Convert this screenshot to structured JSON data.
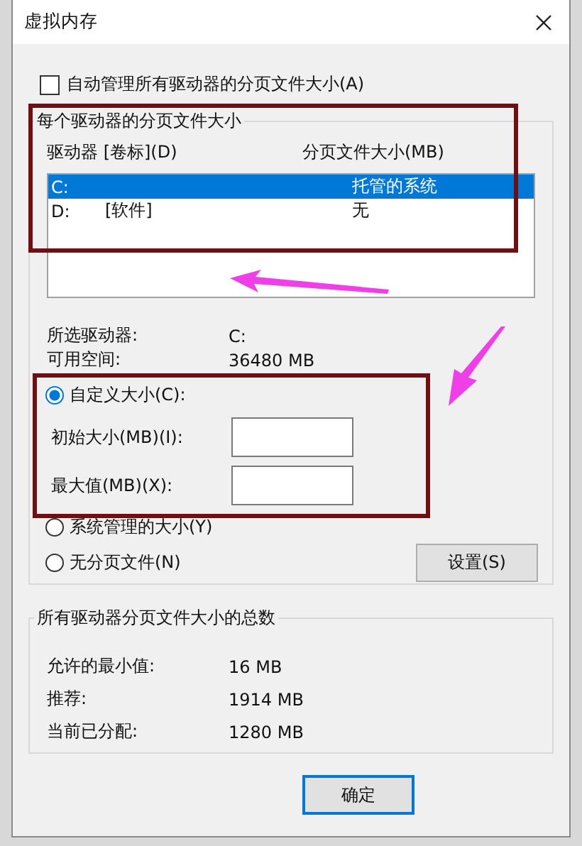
{
  "window": {
    "title": "虚拟内存"
  },
  "auto_manage": {
    "label": "自动管理所有驱动器的分页文件大小(A)",
    "checked": false
  },
  "per_drive": {
    "title": "每个驱动器的分页文件大小",
    "columns": [
      "驱动器 [卷标](D)",
      "分页文件大小(MB)"
    ],
    "drives": [
      {
        "drive": "C:",
        "size": "托管的系统",
        "selected": true
      },
      {
        "drive": "D:",
        "volume": "[软件]",
        "size": "无",
        "selected": false
      }
    ],
    "info": [
      {
        "label": "所选驱动器:",
        "value": "C:"
      },
      {
        "label": "可用空间:",
        "value": "36480 MB"
      }
    ],
    "options": [
      {
        "label": "自定义大小(C):",
        "selected": true,
        "fields": [
          {
            "label": "初始大小(MB)(I):"
          },
          {
            "label": "最大值(MB)(X):"
          }
        ]
      },
      {
        "label": "系统管理的大小(Y)",
        "selected": false
      },
      {
        "label": "无分页文件(N)",
        "selected": false
      }
    ],
    "set_button": "设置(S)"
  },
  "totals": {
    "title": "所有驱动器分页文件大小的总数",
    "rows": [
      {
        "label": "允许的最小值:",
        "value": "16 MB"
      },
      {
        "label": "推荐:",
        "value": "1914 MB"
      },
      {
        "label": "当前已分配:",
        "value": "1280 MB"
      }
    ]
  },
  "buttons": [
    "确定"
  ]
}
